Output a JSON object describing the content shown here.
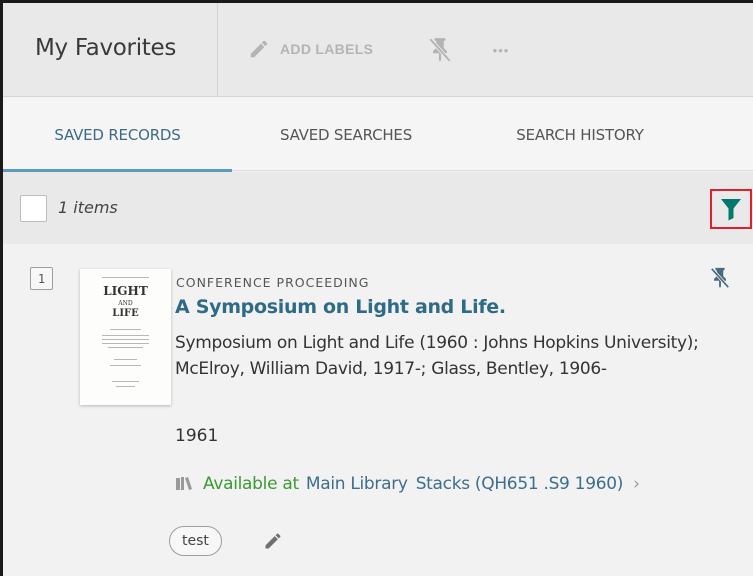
{
  "header": {
    "title": "My Favorites",
    "add_labels": "ADD LABELS",
    "more": "•••"
  },
  "tabs": [
    {
      "label": "SAVED RECORDS",
      "active": true
    },
    {
      "label": "SAVED SEARCHES",
      "active": false
    },
    {
      "label": "SEARCH HISTORY",
      "active": false
    }
  ],
  "toolbar": {
    "count": "1 items"
  },
  "record": {
    "number": "1",
    "type": "CONFERENCE PROCEEDING",
    "title": "A Symposium on Light and Life.",
    "authors": "Symposium on Light and Life (1960 : Johns Hopkins University); McElroy, William David, 1917-; Glass, Bentley, 1906-",
    "year": "1961",
    "availability": {
      "status": "Available at",
      "location": "Main Library",
      "call": "Stacks (QH651 .S9 1960)",
      "chevron": "›"
    },
    "label": "test",
    "thumbnail": {
      "title_lines": [
        "LIGHT",
        "AND",
        "LIFE"
      ]
    }
  },
  "colors": {
    "accent": "#2f6a87",
    "available": "#3b9a35",
    "filter": "#00786e",
    "highlight_border": "#e0202a"
  },
  "icons": {
    "add_labels": "pencil-icon",
    "pin": "pin-off-icon",
    "more": "ellipsis-icon",
    "filter": "filter-icon",
    "availability": "book-open-icon",
    "edit": "pencil-icon"
  }
}
